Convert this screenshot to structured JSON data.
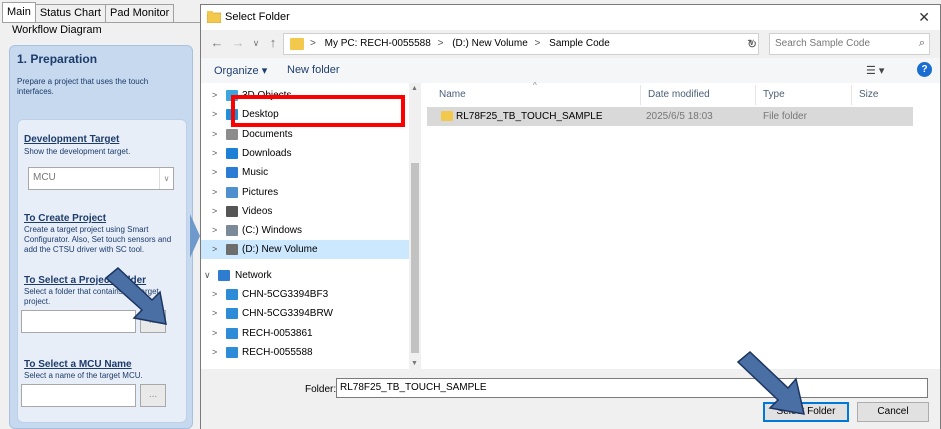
{
  "app": {
    "tabs": [
      "Main",
      "Status Chart",
      "Pad Monitor"
    ],
    "workflow_title": "Workflow Diagram",
    "panel": {
      "title": "1. Preparation",
      "description": "Prepare a project that uses the touch interfaces.",
      "dev_target_title": "Development Target",
      "dev_target_desc": "Show the development target.",
      "dev_target_value": "MCU",
      "create_title": "To Create Project",
      "create_desc": "Create a target project using Smart Configurator. Also, Set touch sensors and add the CTSU driver with SC tool.",
      "select_folder_title": "To Select a Project Folder",
      "select_folder_desc": "Select a folder that contains the target project.",
      "select_mcu_title": "To Select a MCU Name",
      "select_mcu_desc": "Select a name of the target MCU.",
      "browse_label": "..."
    }
  },
  "dialog": {
    "title": "Select Folder",
    "close_glyph": "✕",
    "breadcrumb": [
      "My PC: RECH-0055588",
      "(D:) New Volume",
      "Sample Code"
    ],
    "search_placeholder": "Search Sample Code",
    "toolbar": {
      "organize": "Organize ▾",
      "new_folder": "New folder"
    },
    "tree": [
      {
        "label": "3D Objects",
        "icon": "3d-objects-icon",
        "color": "#3aa6dd",
        "selected": false
      },
      {
        "label": "Desktop",
        "icon": "desktop-icon",
        "color": "#1e90d8",
        "selected": false
      },
      {
        "label": "Documents",
        "icon": "documents-icon",
        "color": "#8c8c8c",
        "selected": false
      },
      {
        "label": "Downloads",
        "icon": "downloads-icon",
        "color": "#1e7fd6",
        "selected": false
      },
      {
        "label": "Music",
        "icon": "music-icon",
        "color": "#2b7bd4",
        "selected": false
      },
      {
        "label": "Pictures",
        "icon": "pictures-icon",
        "color": "#4f8fd0",
        "selected": false
      },
      {
        "label": "Videos",
        "icon": "videos-icon",
        "color": "#555555",
        "selected": false
      },
      {
        "label": "(C:) Windows",
        "icon": "windows-drive-icon",
        "color": "#7a8a99",
        "selected": false
      },
      {
        "label": "(D:) New Volume",
        "icon": "drive-icon",
        "color": "#6d6d6d",
        "selected": true
      }
    ],
    "network": {
      "label": "Network",
      "icon": "network-icon",
      "color": "#2e7dd1"
    },
    "computers": [
      "CHN-5CG3394BF3",
      "CHN-5CG3394BRW",
      "RECH-0053861",
      "RECH-0055588"
    ],
    "columns": [
      "Name",
      "Date modified",
      "Type",
      "Size"
    ],
    "files": [
      {
        "name": "RL78F25_TB_TOUCH_SAMPLE",
        "date": "2025/6/5 18:03",
        "type": "File folder",
        "size": ""
      }
    ],
    "folder_label": "Folder:",
    "folder_value": "RL78F25_TB_TOUCH_SAMPLE",
    "select_button": "Select Folder",
    "cancel_button": "Cancel"
  },
  "colors": {
    "highlight": "#ff0000",
    "annotation_arrow": "#4a6fa5",
    "selection": "#cce8ff"
  }
}
